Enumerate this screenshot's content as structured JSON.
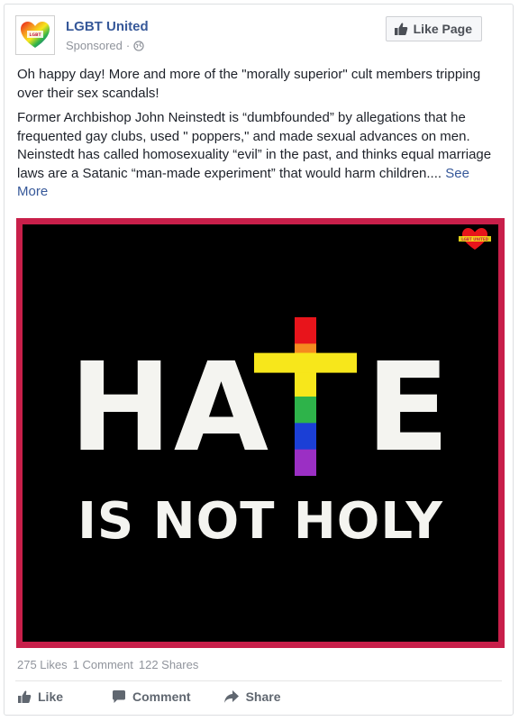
{
  "post": {
    "page_name": "LGBT United",
    "sponsored_label": "Sponsored",
    "sponsored_separator": "·",
    "like_page_label": "Like Page",
    "avatar_text": "LGBT UNITED",
    "paragraph1": "Oh happy day! More and more of the \"morally superior\" cult members tripping over their sex scandals!",
    "paragraph2": "Former Archbishop John Neinstedt is “dumbfounded” by allegations that he frequented gay clubs, used \" poppers,\" and made sexual advances on men. Neinstedt has called homosexuality “evil” in the past, and thinks equal marriage laws are a Satanic “man-made experiment” that would harm children.... ",
    "see_more_label": "See More"
  },
  "image": {
    "headline_left": "HA",
    "headline_right": "E",
    "subline": "IS NOT HOLY",
    "watermark_text": "LGBT UNITED",
    "border_color": "#c81f4a",
    "cross_colors": [
      "#e8141b",
      "#f58a1f",
      "#f7e71b",
      "#2eb34a",
      "#1b3fd6",
      "#9b2fc4"
    ]
  },
  "stats": {
    "likes": "275 Likes",
    "comments": "1 Comment",
    "shares": "122 Shares"
  },
  "actions": {
    "like_label": "Like",
    "comment_label": "Comment",
    "share_label": "Share"
  }
}
